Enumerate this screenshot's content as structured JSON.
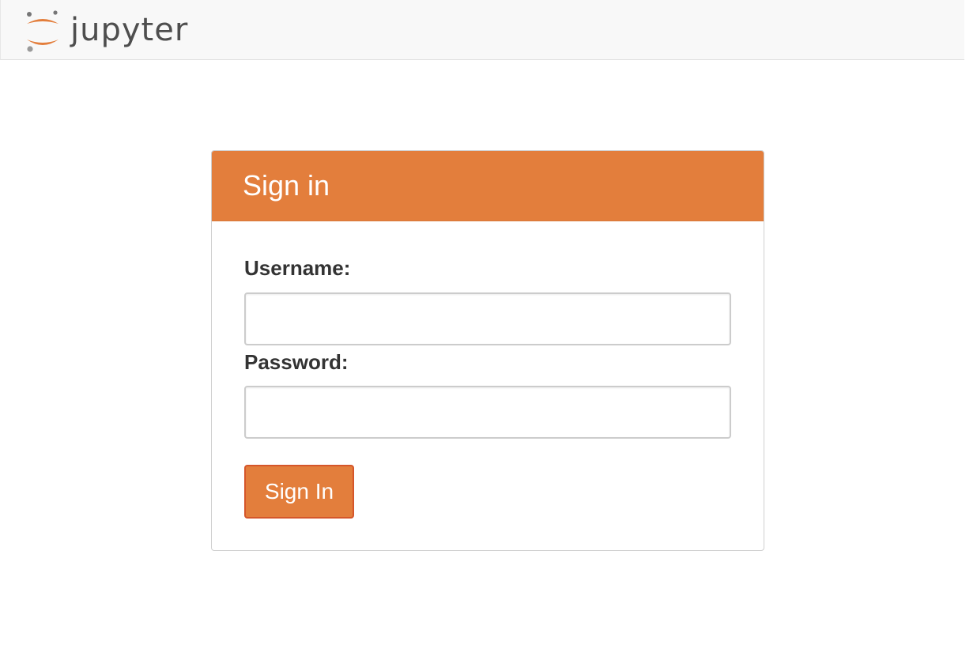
{
  "header": {
    "logo_text": "jupyter"
  },
  "login": {
    "title": "Sign in",
    "username_label": "Username:",
    "username_value": "",
    "password_label": "Password:",
    "password_value": "",
    "submit_label": "Sign In"
  },
  "colors": {
    "brand_orange": "#e37e3c",
    "button_border": "#d5562a",
    "header_bg": "#f8f8f8",
    "text": "#333333"
  },
  "icons": {
    "logo": "jupyter-logo-icon"
  }
}
